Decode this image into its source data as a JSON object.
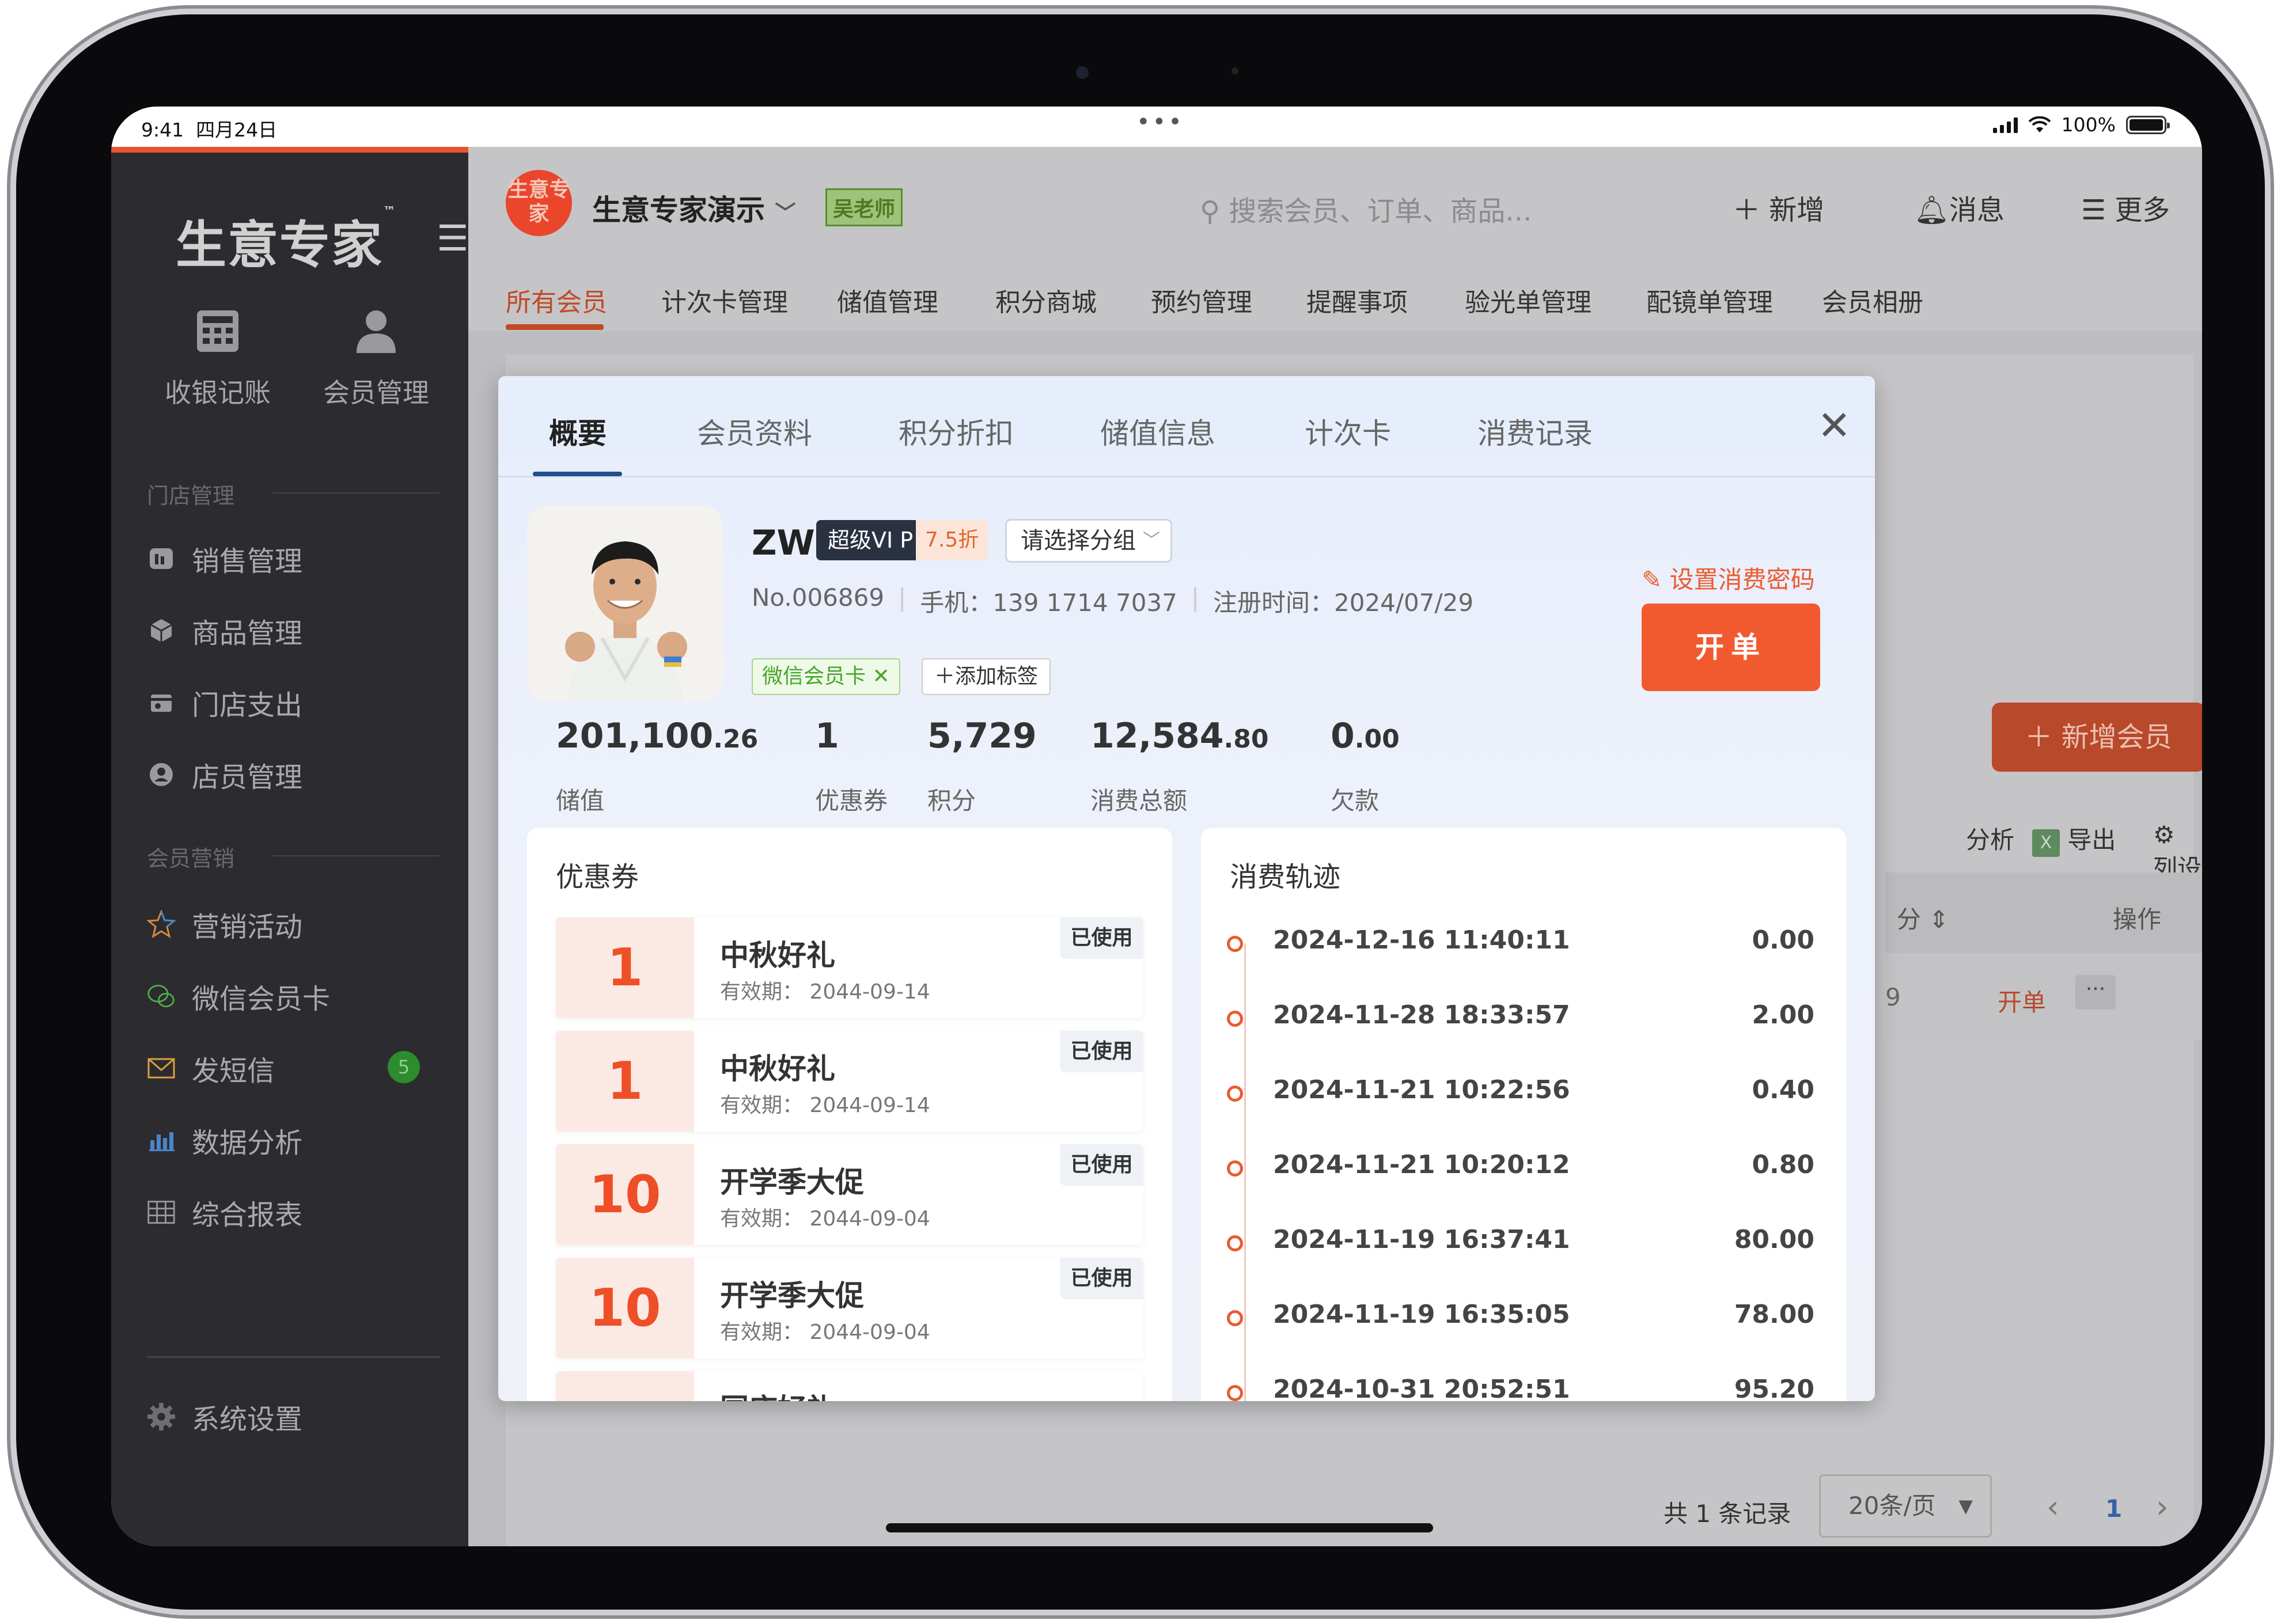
{
  "status": {
    "time": "9:41",
    "date": "四月24日",
    "battery": "100%"
  },
  "sidebar": {
    "logo": "生意专家",
    "tm": "™",
    "quick": [
      {
        "label": "收银记账",
        "icon": "calculator-icon"
      },
      {
        "label": "会员管理",
        "icon": "person-icon"
      }
    ],
    "sections": [
      {
        "title": "门店管理",
        "items": [
          {
            "label": "销售管理",
            "icon": "sales-icon"
          },
          {
            "label": "商品管理",
            "icon": "box-icon"
          },
          {
            "label": "门店支出",
            "icon": "expense-icon"
          },
          {
            "label": "店员管理",
            "icon": "staff-icon"
          }
        ]
      },
      {
        "title": "会员营销",
        "items": [
          {
            "label": "营销活动",
            "icon": "star-icon"
          },
          {
            "label": "微信会员卡",
            "icon": "wechat-icon"
          },
          {
            "label": "发短信",
            "icon": "mail-icon",
            "badge": "5"
          },
          {
            "label": "数据分析",
            "icon": "bar-chart-icon"
          },
          {
            "label": "综合报表",
            "icon": "table-icon"
          }
        ]
      }
    ],
    "settings": "系统设置"
  },
  "header": {
    "shop_logo": "生意专家",
    "shop_name": "生意专家演示",
    "teacher": "吴老师",
    "search_placeholder": "搜索会员、订单、商品...",
    "add": "新增",
    "messages": "消息",
    "more": "更多"
  },
  "tabs": [
    "所有会员",
    "计次卡管理",
    "储值管理",
    "积分商城",
    "预约管理",
    "提醒事项",
    "验光单管理",
    "配镜单管理",
    "会员相册"
  ],
  "background": {
    "new_member": "新增会员",
    "tools": [
      "分析",
      "导出",
      "列设置"
    ],
    "col_sort": "分",
    "col_ops": "操作",
    "row_open": "开单",
    "row_more": "···",
    "row_val": "9",
    "pager_total": "共 1 条记录",
    "page_size": "20条/页",
    "page": "1"
  },
  "modal": {
    "tabs": [
      "概要",
      "会员资料",
      "积分折扣",
      "储值信息",
      "计次卡",
      "消费记录"
    ],
    "name": "ZW",
    "vip": "超级VI P",
    "discount": "7.5折",
    "group_placeholder": "请选择分组",
    "member_no": "No.006869",
    "phone": "手机：139 1714 7037",
    "register": "注册时间：2024/07/29",
    "tag": "微信会员卡",
    "add_tag": "添加标签",
    "set_password": "设置消费密码",
    "open_order": "开单",
    "stats": [
      {
        "int": "201,100",
        "dec": ".26",
        "label": "储值"
      },
      {
        "int": "1",
        "dec": "",
        "label": "优惠券"
      },
      {
        "int": "5,729",
        "dec": "",
        "label": "积分"
      },
      {
        "int": "12,584",
        "dec": ".80",
        "label": "消费总额"
      },
      {
        "int": "0",
        "dec": ".00",
        "label": "欠款"
      }
    ],
    "coupons_title": "优惠券",
    "coupons": [
      {
        "value": "1",
        "name": "中秋好礼",
        "validity": "有效期：  2044-09-14",
        "status": "已使用"
      },
      {
        "value": "1",
        "name": "中秋好礼",
        "validity": "有效期：  2044-09-14",
        "status": "已使用"
      },
      {
        "value": "10",
        "name": "开学季大促",
        "validity": "有效期：  2044-09-04",
        "status": "已使用"
      },
      {
        "value": "10",
        "name": "开学季大促",
        "validity": "有效期：  2044-09-04",
        "status": "已使用"
      },
      {
        "value": "",
        "name": "国庆好礼",
        "validity": "",
        "status": ""
      }
    ],
    "trail_title": "消费轨迹",
    "trail": [
      {
        "time": "2024-12-16 11:40:11",
        "amount": "0.00"
      },
      {
        "time": "2024-11-28 18:33:57",
        "amount": "2.00"
      },
      {
        "time": "2024-11-21 10:22:56",
        "amount": "0.40"
      },
      {
        "time": "2024-11-21 10:20:12",
        "amount": "0.80"
      },
      {
        "time": "2024-11-19 16:37:41",
        "amount": "80.00"
      },
      {
        "time": "2024-11-19 16:35:05",
        "amount": "78.00"
      },
      {
        "time": "2024-10-31 20:52:51",
        "amount": "95.20"
      }
    ]
  }
}
